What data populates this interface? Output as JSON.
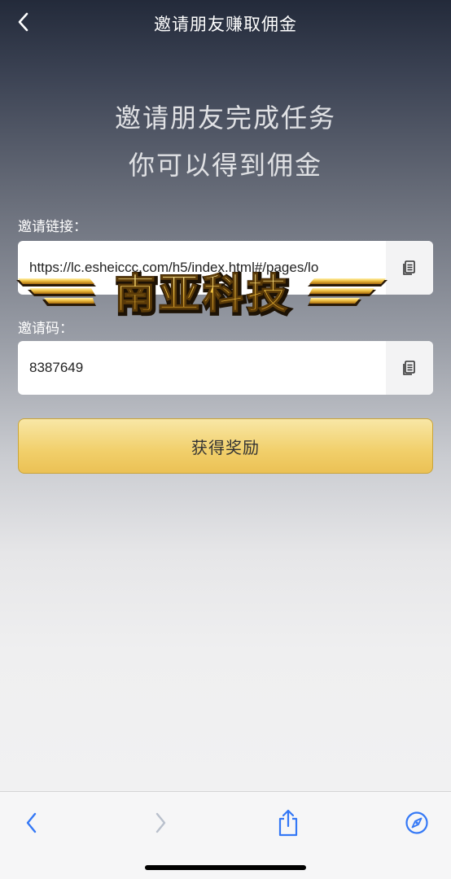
{
  "header": {
    "title": "邀请朋友赚取佣金"
  },
  "hero": {
    "line1": "邀请朋友完成任务",
    "line2": "你可以得到佣金"
  },
  "invite_link": {
    "label": "邀请链接：",
    "value": "https://lc.esheiccc.com/h5/index.html#/pages/lo"
  },
  "invite_code": {
    "label": "邀请码：",
    "value": "8387649"
  },
  "reward_button": {
    "label": "获得奖励"
  },
  "watermark": {
    "text": "南亚科技"
  },
  "colors": {
    "accent_gold": "#f1cf6a",
    "browser_blue": "#3478f6"
  },
  "icons": {
    "back": "chevron-left-icon",
    "copy": "copy-icon",
    "share": "share-icon",
    "compass": "compass-icon"
  }
}
